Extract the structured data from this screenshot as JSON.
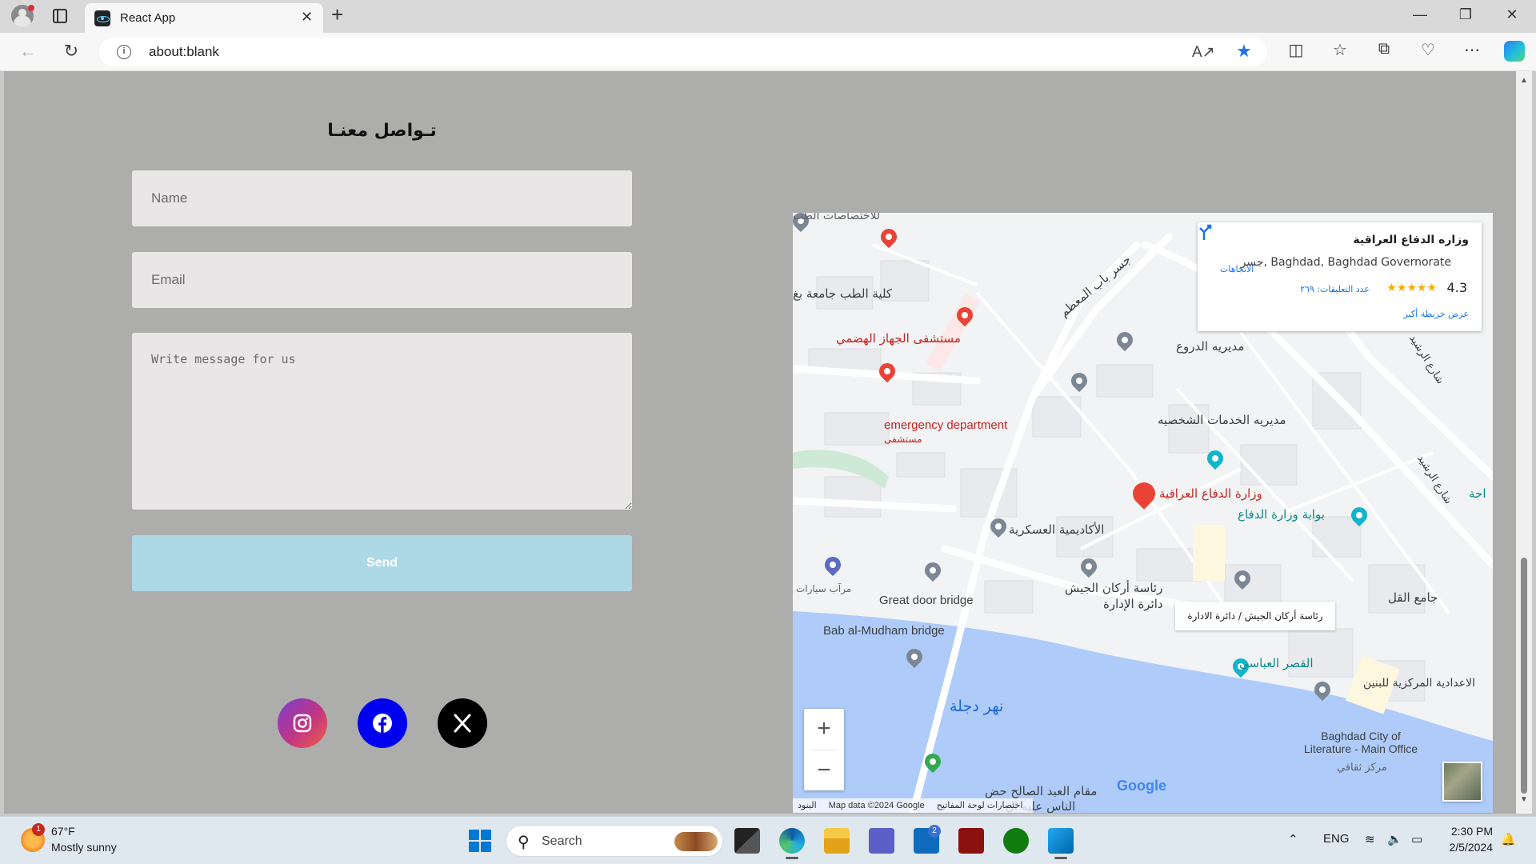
{
  "browser": {
    "tab_title": "React App",
    "url": "about:blank",
    "tab_close": "✕",
    "new_tab": "+"
  },
  "page": {
    "form_title": "تـواصل معنـا",
    "name_placeholder": "Name",
    "email_placeholder": "Email",
    "message_placeholder": "Write message for us",
    "send_label": "Send",
    "social": [
      "instagram",
      "facebook",
      "x"
    ]
  },
  "map": {
    "card": {
      "title": "وزاره الدفاع العراقية",
      "address": "جسر, Baghdad, Baghdad Governorate",
      "rating": "4.3",
      "stars": "★★★★★",
      "reviews": "عدد التعليقات: ٢٦٩",
      "larger_map": "عرض خريطة أكبر",
      "directions": "الاتجاهات"
    },
    "labels": {
      "top_left": "للاختصاصات الطب",
      "medicine": "كلية الطب جامعة بغ",
      "digestive": "مستشفى الجهاز الهضمي",
      "bridge_road": "جسر باب المعظم",
      "directorate": "مديريه الدروع",
      "emergency": "emergency department",
      "emergency_ar": "مستشفى",
      "personal": "مديريه الخدمات الشخصيه",
      "rasheed1": "شارع الرشيد",
      "rasheed2": "شارع الرشيد",
      "ministry": "وزارة الدفاع العراقية",
      "gate": "بوابة وزارة الدفاع",
      "academy": "الأكاديمية العسكرية",
      "parking": "مرآب سيارات",
      "great_door": "Great door bridge",
      "staff": "رئاسة أركان الجيش",
      "admin": "دائرة الإدارة",
      "mosque": "جامع القل",
      "bab_mudham": "Bab al-Mudham bridge",
      "abbasid": "القصر العباسي",
      "tigris": "نهر دجلة",
      "prep": "الاعدادية المركزية للبنين",
      "literature": "Baghdad City of Literature - Main Office",
      "cultural": "مركز ثقافي",
      "shrine": "مقام العبد الصالح حض",
      "shrine2": "الناس عليه ال",
      "plaza": "احة",
      "tooltip": "رئاسة أركان الجيش / دائرة الادارة"
    },
    "zoom_in": "+",
    "zoom_out": "−",
    "google": "Google",
    "attrib_keys": "اختصارات لوحة المفاتيح",
    "attrib_data": "Map data ©2024 Google",
    "attrib_terms": "البنود"
  },
  "taskbar": {
    "weather_temp": "67°F",
    "weather_desc": "Mostly sunny",
    "weather_badge": "1",
    "search_label": "Search",
    "teams_badge": "2",
    "lang": "ENG",
    "time": "2:30 PM",
    "date": "2/5/2024"
  }
}
